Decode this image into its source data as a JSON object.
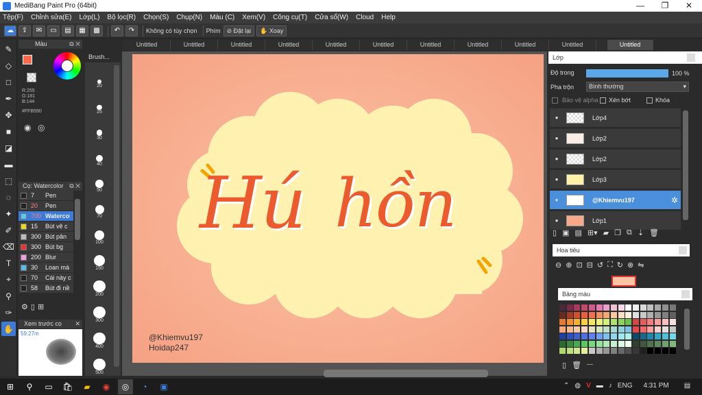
{
  "window": {
    "title": "MediBang Paint Pro (64bit)",
    "min": "—",
    "max": "❐",
    "close": "✕"
  },
  "menu": [
    "Tệp(F)",
    "Chỉnh sửa(E)",
    "Lớp(L)",
    "Bộ lọc(R)",
    "Chọn(S)",
    "Chụp(N)",
    "Màu (C)",
    "Xem(V)",
    "Công cụ(T)",
    "Cửa sổ(W)",
    "Cloud",
    "Help"
  ],
  "toolbar": {
    "mode_label": "Không có tùy chọn",
    "phim_label": "Phím",
    "reset_label": "Đặt lại",
    "rotate_label": "Xoay"
  },
  "tabs": [
    "Untitled",
    "Untitled",
    "Untitled",
    "Untitled",
    "Untitled",
    "Untitled",
    "Untitled",
    "Untitled",
    "Untitled",
    "Untitled",
    "Untitled",
    "Untitled"
  ],
  "active_tab": 11,
  "color_panel": {
    "title": "Màu",
    "r": "R:255",
    "g": "G:181",
    "b": "B:144",
    "hex": "#FFB590",
    "primary": "#ff6a4b",
    "secondary": "#ffffff"
  },
  "brush_panel": {
    "title": "Cọ: Watercolor",
    "items": [
      {
        "size": "7",
        "name": "Pen",
        "color": "#222222"
      },
      {
        "size": "20",
        "name": "Pen",
        "color": "#222222"
      },
      {
        "size": "700",
        "name": "Watercolor",
        "color": "#55ccee",
        "selected": true
      },
      {
        "size": "15",
        "name": "Bút vẽ c",
        "color": "#e8d820"
      },
      {
        "size": "300",
        "name": "Bút pân",
        "color": "#bbbbbb"
      },
      {
        "size": "300",
        "name": "Bút bg",
        "color": "#ee3333"
      },
      {
        "size": "200",
        "name": "Blur",
        "color": "#f0a0e0"
      },
      {
        "size": "30",
        "name": "Loan mà",
        "color": "#55bbee"
      },
      {
        "size": "70",
        "name": "Cái này c",
        "color": "#222222"
      },
      {
        "size": "58",
        "name": "Bút đi nề",
        "color": "#222222"
      }
    ]
  },
  "preview_panel": {
    "title": "Xem trước cọ",
    "size": "59.27m"
  },
  "brush_sizes": {
    "title": "Brush...",
    "sizes": [
      "20",
      "25",
      "30",
      "40",
      "50",
      "70",
      "100",
      "150",
      "200",
      "300",
      "400",
      "500"
    ]
  },
  "canvas": {
    "main_text_1": "Hú",
    "main_text_2": "hồn",
    "credit_1": "@Khiemvu197",
    "credit_2": "Hoidap247"
  },
  "layer_panel": {
    "title": "Lớp",
    "opacity_label": "Độ trong",
    "opacity_value": "100 %",
    "opacity_fraction": 1.0,
    "blend_label": "Pha trộn",
    "blend_value": "Bình thường",
    "protect_alpha": "Bảo vệ alpha",
    "clipping": "Xén bớt",
    "lock": "Khóa",
    "layers": [
      {
        "name": "Lớp4",
        "thumb": "#f0f0f0"
      },
      {
        "name": "Lớp2",
        "thumb": "#fbeee6"
      },
      {
        "name": "Lớp2",
        "thumb": "#f0f0f0"
      },
      {
        "name": "Lớp3",
        "thumb": "#fff2a8"
      },
      {
        "name": "@Khiemvu197",
        "thumb": "#ffffff",
        "selected": true
      },
      {
        "name": "Lớp1",
        "thumb": "#f8a987"
      }
    ]
  },
  "nav_panel": {
    "title": "Hoa tiêu"
  },
  "palette_panel": {
    "title": "Bảng màu",
    "footer": "---"
  },
  "taskbar": {
    "lang": "ENG",
    "time": "4:31 PM"
  }
}
